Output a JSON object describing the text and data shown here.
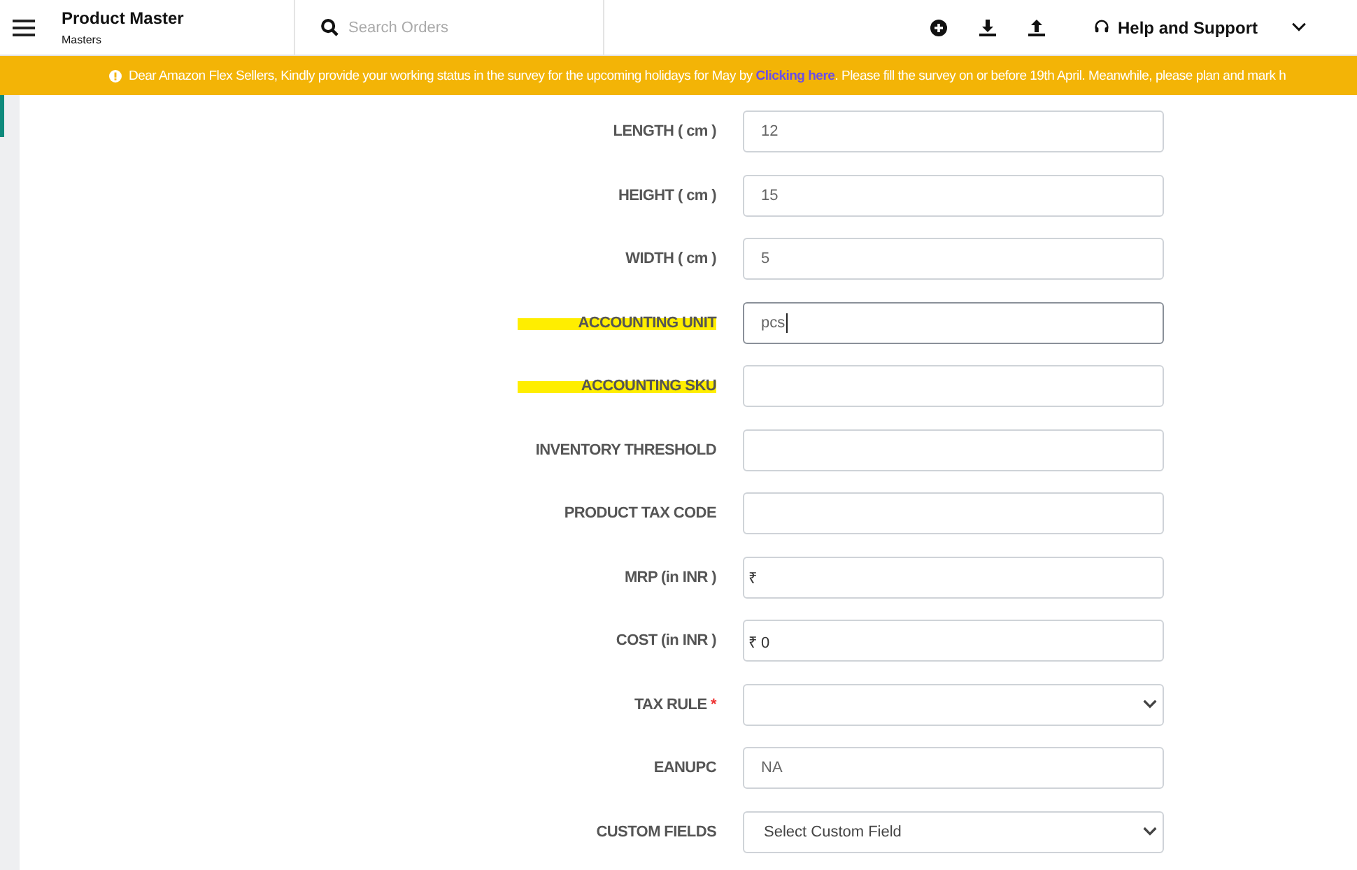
{
  "header": {
    "title": "Product Master",
    "subtitle": "Masters",
    "search": {
      "placeholder": "Search Orders"
    },
    "help": "Help and Support"
  },
  "banner": {
    "before": "Dear Amazon Flex Sellers, Kindly provide your working status in the survey for the upcoming holidays for May by ",
    "link": "Clicking here",
    "after": ". Please fill the survey on or before 19th April. Meanwhile, please plan and mark h"
  },
  "fields": [
    {
      "label": "LENGTH ( cm )",
      "kind": "input",
      "value": "12",
      "highlighted": false
    },
    {
      "label": "HEIGHT ( cm )",
      "kind": "input",
      "value": "15",
      "highlighted": false
    },
    {
      "label": "WIDTH ( cm )",
      "kind": "input",
      "value": "5",
      "highlighted": false
    },
    {
      "label": "ACCOUNTING UNIT",
      "kind": "input",
      "value": "pcs",
      "highlighted": true,
      "focused": true
    },
    {
      "label": "ACCOUNTING SKU",
      "kind": "input",
      "highlighted": true
    },
    {
      "label": "INVENTORY THRESHOLD",
      "kind": "input",
      "highlighted": false
    },
    {
      "label": "PRODUCT TAX CODE",
      "kind": "input",
      "highlighted": false
    },
    {
      "label": "MRP (in INR )",
      "kind": "currency",
      "prefix": "₹",
      "highlighted": false
    },
    {
      "label": "COST (in INR )",
      "kind": "currency",
      "prefix": "₹",
      "value": "0",
      "highlighted": false
    },
    {
      "label": "TAX RULE",
      "kind": "select",
      "required": true,
      "required_mark": "*",
      "highlighted": false
    },
    {
      "label": "EANUPC",
      "kind": "input",
      "value": "NA",
      "highlighted": false
    },
    {
      "label": "CUSTOM FIELDS",
      "kind": "select",
      "value": "Select Custom Field",
      "highlighted": false
    }
  ]
}
